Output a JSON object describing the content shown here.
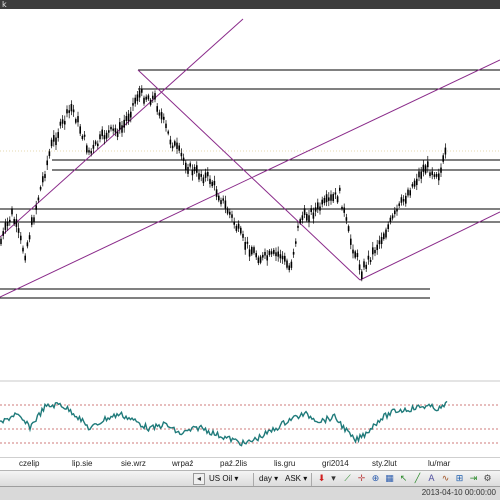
{
  "window": {
    "title": "k"
  },
  "chart": {
    "symbol": "US Oil",
    "oscillator_color": "#1f7a7a",
    "trendline_color": "#8a2b8a",
    "level_color": "#000000",
    "candle_color": "#000000"
  },
  "time_axis": {
    "labels": [
      "czelip",
      "lip.sie",
      "sie.wrz",
      "wrpaź",
      "paź.2lis",
      "lis.gru",
      "gri2014",
      "sty.2lut",
      "lu/mar"
    ]
  },
  "toolbar": {
    "symbol_label": "US Oil",
    "timeframe_label": "day",
    "price_type_label": "ASK",
    "items": [
      {
        "name": "prev-symbol-button",
        "glyph": "◀"
      },
      {
        "name": "next-symbol-button",
        "glyph": "▶"
      },
      {
        "name": "sell-icon",
        "glyph": "●"
      },
      {
        "name": "settings-icon",
        "glyph": "⚙"
      }
    ]
  },
  "status": {
    "timestamp": "2013-04-10 00:00:00"
  }
}
